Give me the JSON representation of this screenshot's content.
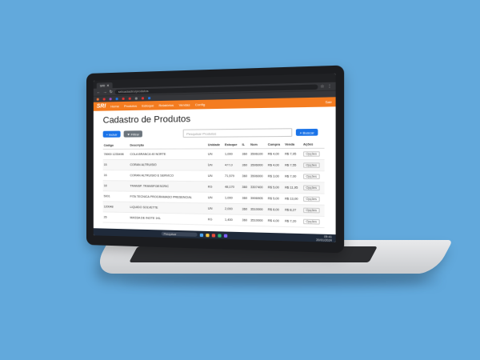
{
  "browser": {
    "tab_title": "SRI",
    "url": "sri/cadastro/produtos",
    "bookmarks": [
      "",
      "",
      "",
      "",
      "",
      "",
      "",
      "",
      ""
    ]
  },
  "app": {
    "logo": "SRI",
    "menu": [
      "Home",
      "Produtos",
      "Estoque",
      "Relatórios",
      "Vendas",
      "Config"
    ],
    "user": "Sair"
  },
  "page": {
    "title": "Cadastro de Produtos",
    "new_button": "Incluir",
    "filter_button": "Filtrar",
    "search_placeholder": "Pesquisar Produtos",
    "search_button": "Buscar"
  },
  "table": {
    "headers": [
      "Código",
      "Descrição",
      "Unidade",
      "Estoque",
      "IL",
      "Ncm",
      "Compra",
      "Venda",
      "Ações"
    ],
    "rows": [
      [
        "78900 1235498",
        "COLA BRANCA 40 NORTE",
        "UN",
        "1,000",
        "360",
        "3506100",
        "R$ 4,00",
        "R$ 7,95",
        "Opções"
      ],
      [
        "15",
        "CORAN ALTRUISIO",
        "UN",
        "477,0",
        "360",
        "3506000",
        "R$ 4,00",
        "R$ 7,55",
        "Opções"
      ],
      [
        "16",
        "CORAN ALTRUISIO E SERVICO",
        "UN",
        "71,579",
        "360",
        "3506000",
        "R$ 3,00",
        "R$ 7,00",
        "Opções"
      ],
      [
        "18",
        "TRANSP. TRANSP.DESCRIC",
        "KG",
        "48,170",
        "360",
        "3307400",
        "R$ 5,00",
        "R$ 11,95",
        "Opções"
      ],
      [
        "5001",
        "FITA TECNICA PROGRAMADO PRESENCIAL",
        "UN",
        "1,000",
        "360",
        "3906905",
        "R$ 5,00",
        "R$ 13,00",
        "Opções"
      ],
      [
        "120048",
        "LIQUIDO SOLVETTE",
        "UN",
        "2,000",
        "360",
        "3510000",
        "R$ 8,00",
        "R$ 8,27",
        "Opções"
      ],
      [
        "26",
        "MASSA DE INOTE 1KL",
        "KG",
        "1,400",
        "360",
        "3510000",
        "R$ 4,00",
        "R$ 7,20",
        "Opções"
      ]
    ]
  },
  "taskbar": {
    "search": "Pesquisar",
    "time": "09:41",
    "date": "20/01/2024"
  },
  "colors": {
    "background": "#62a9dc",
    "appbar": "#f47c20",
    "primary_button": "#1a73e8"
  }
}
